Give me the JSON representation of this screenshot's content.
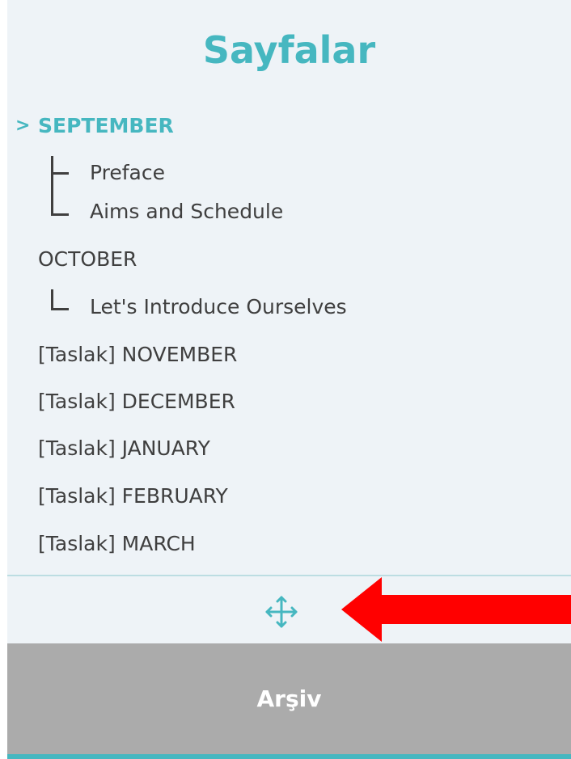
{
  "panel": {
    "title": "Sayfalar",
    "accent_color": "#46b7c0"
  },
  "nav": {
    "active_indicator": ">",
    "items": [
      {
        "label": "SEPTEMBER",
        "active": true,
        "children": [
          "Preface",
          "Aims and Schedule"
        ]
      },
      {
        "label": "OCTOBER",
        "active": false,
        "children": [
          "Let's Introduce Ourselves"
        ]
      },
      {
        "label": "[Taslak] NOVEMBER",
        "active": false,
        "children": []
      },
      {
        "label": "[Taslak] DECEMBER",
        "active": false,
        "children": []
      },
      {
        "label": "[Taslak] JANUARY",
        "active": false,
        "children": []
      },
      {
        "label": "[Taslak] FEBRUARY",
        "active": false,
        "children": []
      },
      {
        "label": "[Taslak] MARCH",
        "active": false,
        "children": []
      }
    ]
  },
  "move_handle": {
    "icon": "move-icon"
  },
  "annotation": {
    "icon": "red-arrow",
    "color": "#ff0000"
  },
  "footer": {
    "archive_label": "Arşiv",
    "button_color": "#ababab"
  }
}
